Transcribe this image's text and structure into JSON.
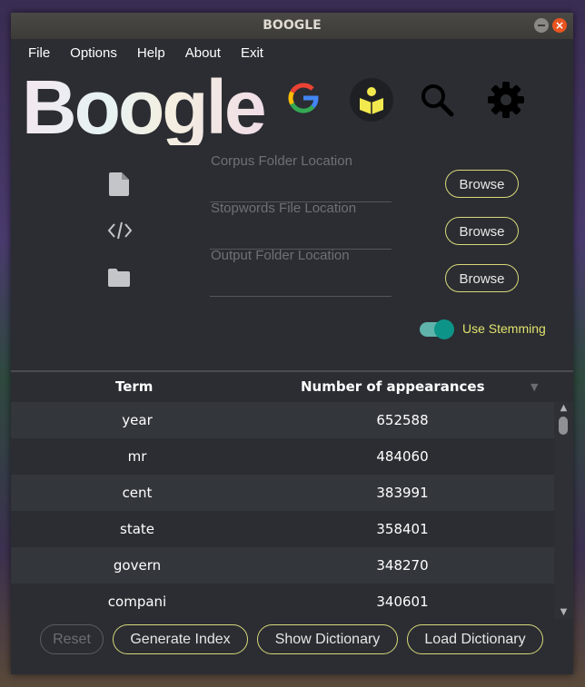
{
  "window": {
    "title": "BOOGLE",
    "close_glyph": "×"
  },
  "menu": [
    "File",
    "Options",
    "Help",
    "About",
    "Exit"
  ],
  "logo": "Boogle",
  "toolbar_icons": [
    "google-icon",
    "dictionary-reader-icon",
    "search-icon",
    "settings-gear-icon"
  ],
  "fields": [
    {
      "icon": "document-icon",
      "placeholder": "Corpus Folder Location",
      "value": "",
      "button": "Browse"
    },
    {
      "icon": "code-icon",
      "placeholder": "Stopwords File Location",
      "value": "",
      "button": "Browse"
    },
    {
      "icon": "folder-icon",
      "placeholder": "Output Folder Location",
      "value": "",
      "button": "Browse"
    }
  ],
  "stemming": {
    "label": "Use Stemming",
    "enabled": true
  },
  "table": {
    "headers": [
      "Term",
      "Number of appearances"
    ],
    "sort_glyph": "▼",
    "rows": [
      [
        "year",
        "652588"
      ],
      [
        "mr",
        "484060"
      ],
      [
        "cent",
        "383991"
      ],
      [
        "state",
        "358401"
      ],
      [
        "govern",
        "348270"
      ],
      [
        "compani",
        "340601"
      ]
    ],
    "scroll_up_glyph": "▲",
    "scroll_down_glyph": "▼"
  },
  "buttons": {
    "reset": "Reset",
    "generate": "Generate Index",
    "show": "Show Dictionary",
    "load": "Load Dictionary"
  },
  "colors": {
    "background": "#2b2d32",
    "accent_border": "#d8d87a",
    "stemming_label": "#e2e26c",
    "toggle_on": "#0d9488"
  }
}
